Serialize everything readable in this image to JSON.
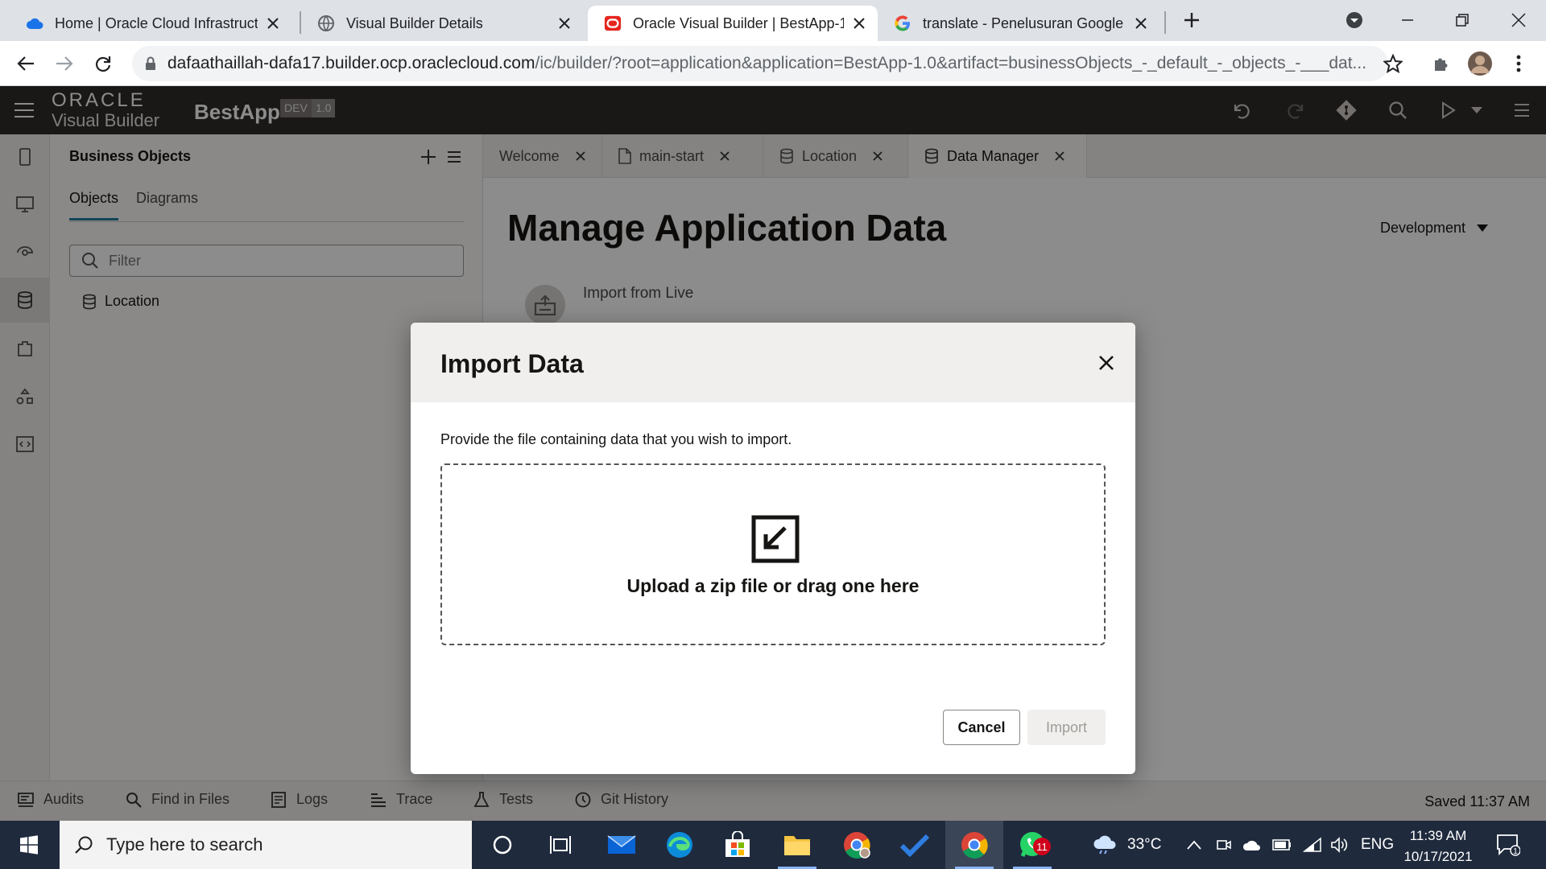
{
  "browser": {
    "tabs": [
      {
        "title": "Home | Oracle Cloud Infrastructu",
        "icon": "cloud-icon"
      },
      {
        "title": "Visual Builder Details",
        "icon": "globe-icon"
      },
      {
        "title": "Oracle Visual Builder | BestApp-1",
        "icon": "oracle-icon"
      },
      {
        "title": "translate - Penelusuran Google",
        "icon": "google-icon"
      }
    ],
    "url_host": "dafaathaillah-dafa17.builder.ocp.oraclecloud.com",
    "url_path": "/ic/builder/?root=application&application=BestApp-1.0&artifact=businessObjects_-_default_-_objects_-___dat..."
  },
  "vb": {
    "logo_top": "ORACLE",
    "logo_bottom": "Visual Builder",
    "app_name": "BestApp",
    "badge_env": "DEV",
    "badge_version": "1.0"
  },
  "bo_panel": {
    "title": "Business Objects",
    "tabs": [
      "Objects",
      "Diagrams"
    ],
    "filter_placeholder": "Filter",
    "items": [
      "Location"
    ]
  },
  "editor_tabs": [
    {
      "label": "Welcome"
    },
    {
      "label": "main-start"
    },
    {
      "label": "Location"
    },
    {
      "label": "Data Manager"
    }
  ],
  "main": {
    "title": "Manage Application Data",
    "environment": "Development",
    "import_live": "Import from Live"
  },
  "dialog": {
    "title": "Import Data",
    "description": "Provide the file containing data that you wish to import.",
    "dropzone_text": "Upload a zip file or drag one here",
    "cancel": "Cancel",
    "import": "Import"
  },
  "bottom_bar": {
    "items": [
      "Audits",
      "Find in Files",
      "Logs",
      "Trace",
      "Tests",
      "Git History"
    ],
    "saved": "Saved 11:37 AM"
  },
  "taskbar": {
    "search_placeholder": "Type here to search",
    "weather": "33°C",
    "lang": "ENG",
    "time": "11:39 AM",
    "date": "10/17/2021",
    "whatsapp_badge": "11",
    "notification_count": "1"
  }
}
